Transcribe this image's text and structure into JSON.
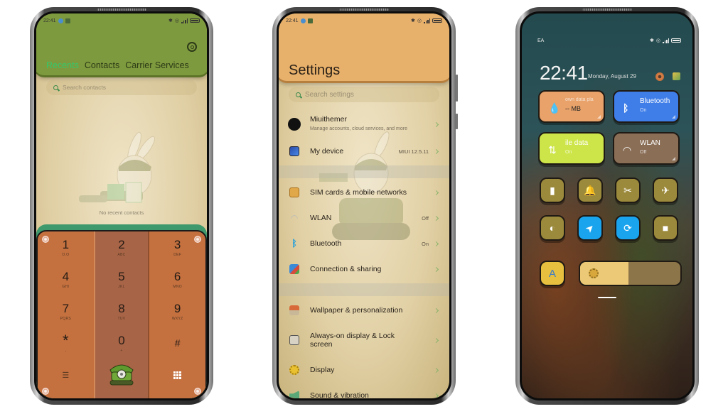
{
  "status_bar": {
    "time": "22:41",
    "carrier_label": "EA"
  },
  "dialer": {
    "tabs": [
      {
        "label": "Recents",
        "active": true
      },
      {
        "label": "Contacts",
        "active": false
      },
      {
        "label": "Carrier Services",
        "active": false
      }
    ],
    "search_placeholder": "Search contacts",
    "empty_message": "No recent contacts",
    "keys": [
      {
        "num": "1",
        "letters": "O.O"
      },
      {
        "num": "2",
        "letters": "ABC"
      },
      {
        "num": "3",
        "letters": "DEF"
      },
      {
        "num": "4",
        "letters": "GHI"
      },
      {
        "num": "5",
        "letters": "JKL"
      },
      {
        "num": "6",
        "letters": "MNO"
      },
      {
        "num": "7",
        "letters": "PQRS"
      },
      {
        "num": "8",
        "letters": "TUV"
      },
      {
        "num": "9",
        "letters": "WXYZ"
      },
      {
        "num": "*",
        "letters": ","
      },
      {
        "num": "0",
        "letters": "+"
      },
      {
        "num": "#",
        "letters": ""
      }
    ],
    "icons": {
      "settings": "gear-icon",
      "menu": "list-menu-icon",
      "call": "tank-phone-call-icon",
      "keypad": "keypad-icon"
    },
    "colors": {
      "header": "#7e9a3e",
      "active_tab": "#35c76a",
      "keypad": "#c4703f",
      "keypad_mid": "#a86447",
      "frame": "#3e9a6c"
    }
  },
  "settings": {
    "title": "Settings",
    "search_placeholder": "Search settings",
    "groups": [
      [
        {
          "label": "Miuithemer",
          "sub": "Manage accounts, cloud services, and more",
          "icon": "account-icon",
          "value": ""
        },
        {
          "label": "My device",
          "sub": "",
          "icon": "device-icon",
          "value": "MIUI 12.5.11"
        }
      ],
      [
        {
          "label": "SIM cards & mobile networks",
          "sub": "",
          "icon": "sim-card-icon",
          "value": ""
        },
        {
          "label": "WLAN",
          "sub": "",
          "icon": "wifi-icon",
          "value": "Off"
        },
        {
          "label": "Bluetooth",
          "sub": "",
          "icon": "bluetooth-icon",
          "value": "On"
        },
        {
          "label": "Connection & sharing",
          "sub": "",
          "icon": "connection-icon",
          "value": ""
        }
      ],
      [
        {
          "label": "Wallpaper & personalization",
          "sub": "",
          "icon": "wallpaper-icon",
          "value": ""
        },
        {
          "label": "Always-on display & Lock screen",
          "sub": "",
          "icon": "lock-icon",
          "value": ""
        },
        {
          "label": "Display",
          "sub": "",
          "icon": "display-icon",
          "value": ""
        },
        {
          "label": "Sound & vibration",
          "sub": "",
          "icon": "sound-icon",
          "value": ""
        }
      ]
    ],
    "colors": {
      "header": "#e8b16b",
      "chevron": "#8ab36a"
    }
  },
  "control_center": {
    "clock": "22:41",
    "date": "Monday, August 29",
    "tiles": [
      {
        "title": "own data pla",
        "sub": "-- MB",
        "icon": "water-drop-icon",
        "color": "#e8a26a"
      },
      {
        "title": "Bluetooth",
        "sub": "On",
        "icon": "bluetooth-icon",
        "color": "#3f7ee8"
      },
      {
        "title": "ile data",
        "sub": "On",
        "icon": "mobile-data-icon",
        "color": "#cde548"
      },
      {
        "title": "WLAN",
        "sub": "Off",
        "icon": "wifi-icon",
        "color": "#8a6e56"
      }
    ],
    "toggles_row1": [
      {
        "name": "flashlight",
        "glyph": "▮",
        "active": false
      },
      {
        "name": "notifications",
        "glyph": "🔔",
        "active": false
      },
      {
        "name": "screenshot",
        "glyph": "✂",
        "active": false
      },
      {
        "name": "airplane-mode",
        "glyph": "✈",
        "active": false
      }
    ],
    "toggles_row2": [
      {
        "name": "dark-mode",
        "glyph": "◐",
        "active": false
      },
      {
        "name": "location",
        "glyph": "➤",
        "active": true
      },
      {
        "name": "rotation-lock",
        "glyph": "⟳",
        "active": true
      },
      {
        "name": "screen-record",
        "glyph": "■",
        "active": false
      }
    ],
    "auto_brightness_label": "A",
    "brightness_percent": 48
  }
}
